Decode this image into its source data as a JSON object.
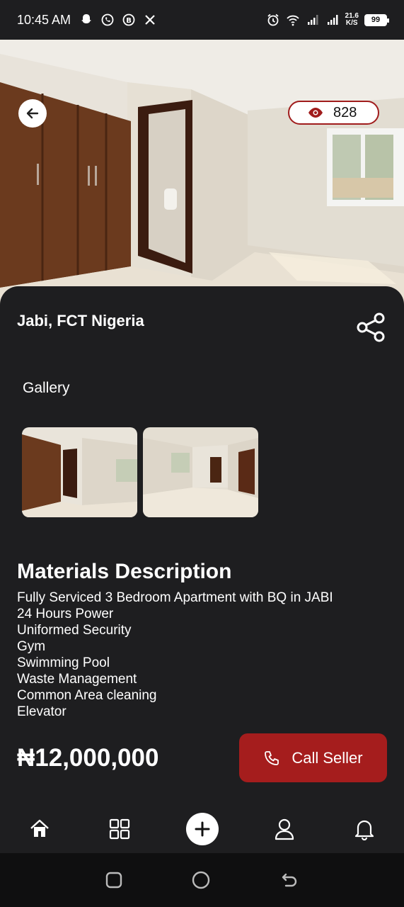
{
  "status_bar": {
    "time": "10:45 AM",
    "speed_value": "21.6",
    "speed_unit": "K/S",
    "battery": "99"
  },
  "hero": {
    "views": "828"
  },
  "listing": {
    "location": "Jabi, FCT Nigeria",
    "gallery_label": "Gallery",
    "description_title": "Materials Description",
    "description_lines": [
      "Fully Serviced 3 Bedroom Apartment with BQ in JABI",
      "24 Hours Power",
      "Uniformed Security",
      "Gym",
      "Swimming Pool",
      "Waste Management",
      "Common Area cleaning",
      "Elevator"
    ],
    "price": "₦12,000,000",
    "call_label": "Call Seller"
  },
  "colors": {
    "accent": "#a51d1d",
    "background": "#1e1e20"
  }
}
